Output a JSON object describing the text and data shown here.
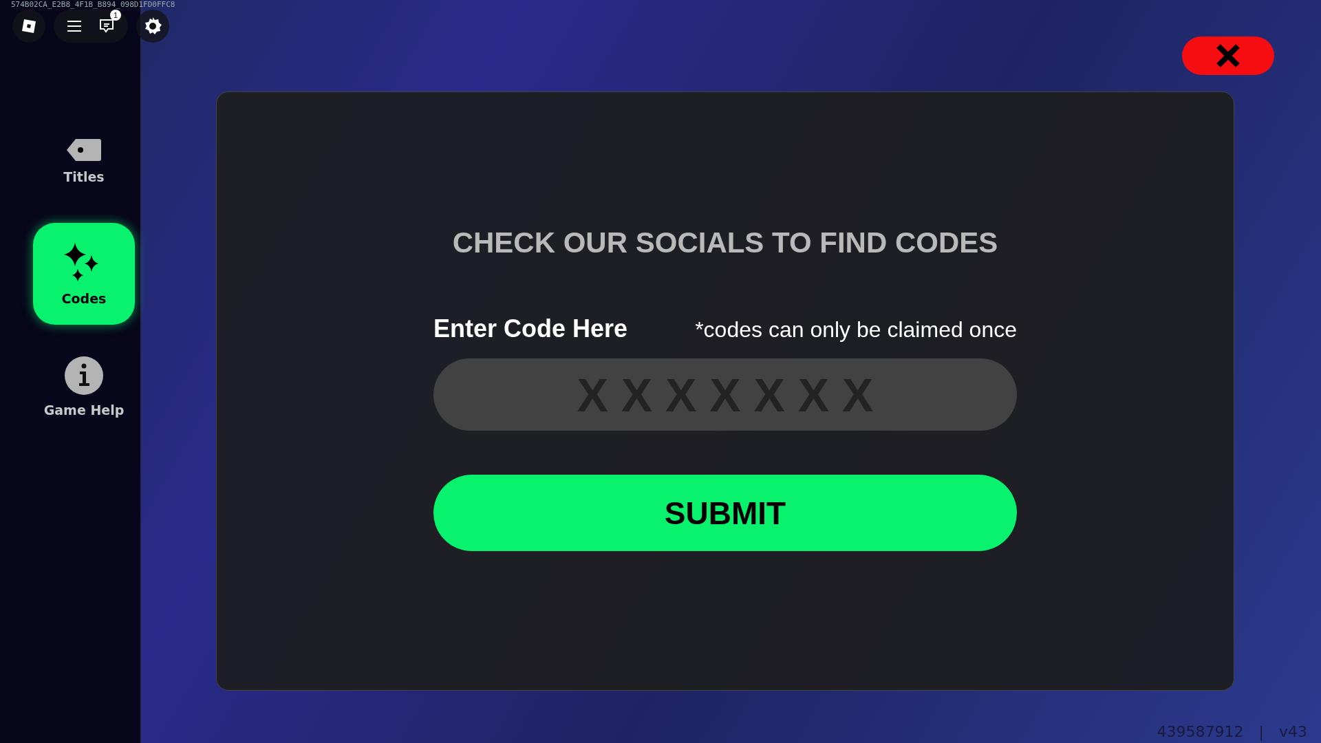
{
  "debug_id": "574B02CA_E2B8_4F1B_B894_098D1FD0FFC8",
  "top_bar": {
    "chat_badge": "1"
  },
  "sidebar": {
    "items": [
      {
        "label": "Titles",
        "kind": "tag",
        "selected": false
      },
      {
        "label": "Codes",
        "kind": "sparkles",
        "selected": true
      },
      {
        "label": "Game Help",
        "kind": "info",
        "selected": false
      }
    ]
  },
  "modal": {
    "title": "CHECK OUR SOCIALS TO FIND CODES",
    "field_label": "Enter Code Here",
    "note": "*codes can only be claimed once",
    "code_field": {
      "placeholder": "X X X X X X X"
    },
    "submit": "SUBMIT"
  },
  "footer": {
    "server_id": "439587912",
    "separator": "|",
    "version": "v43"
  }
}
